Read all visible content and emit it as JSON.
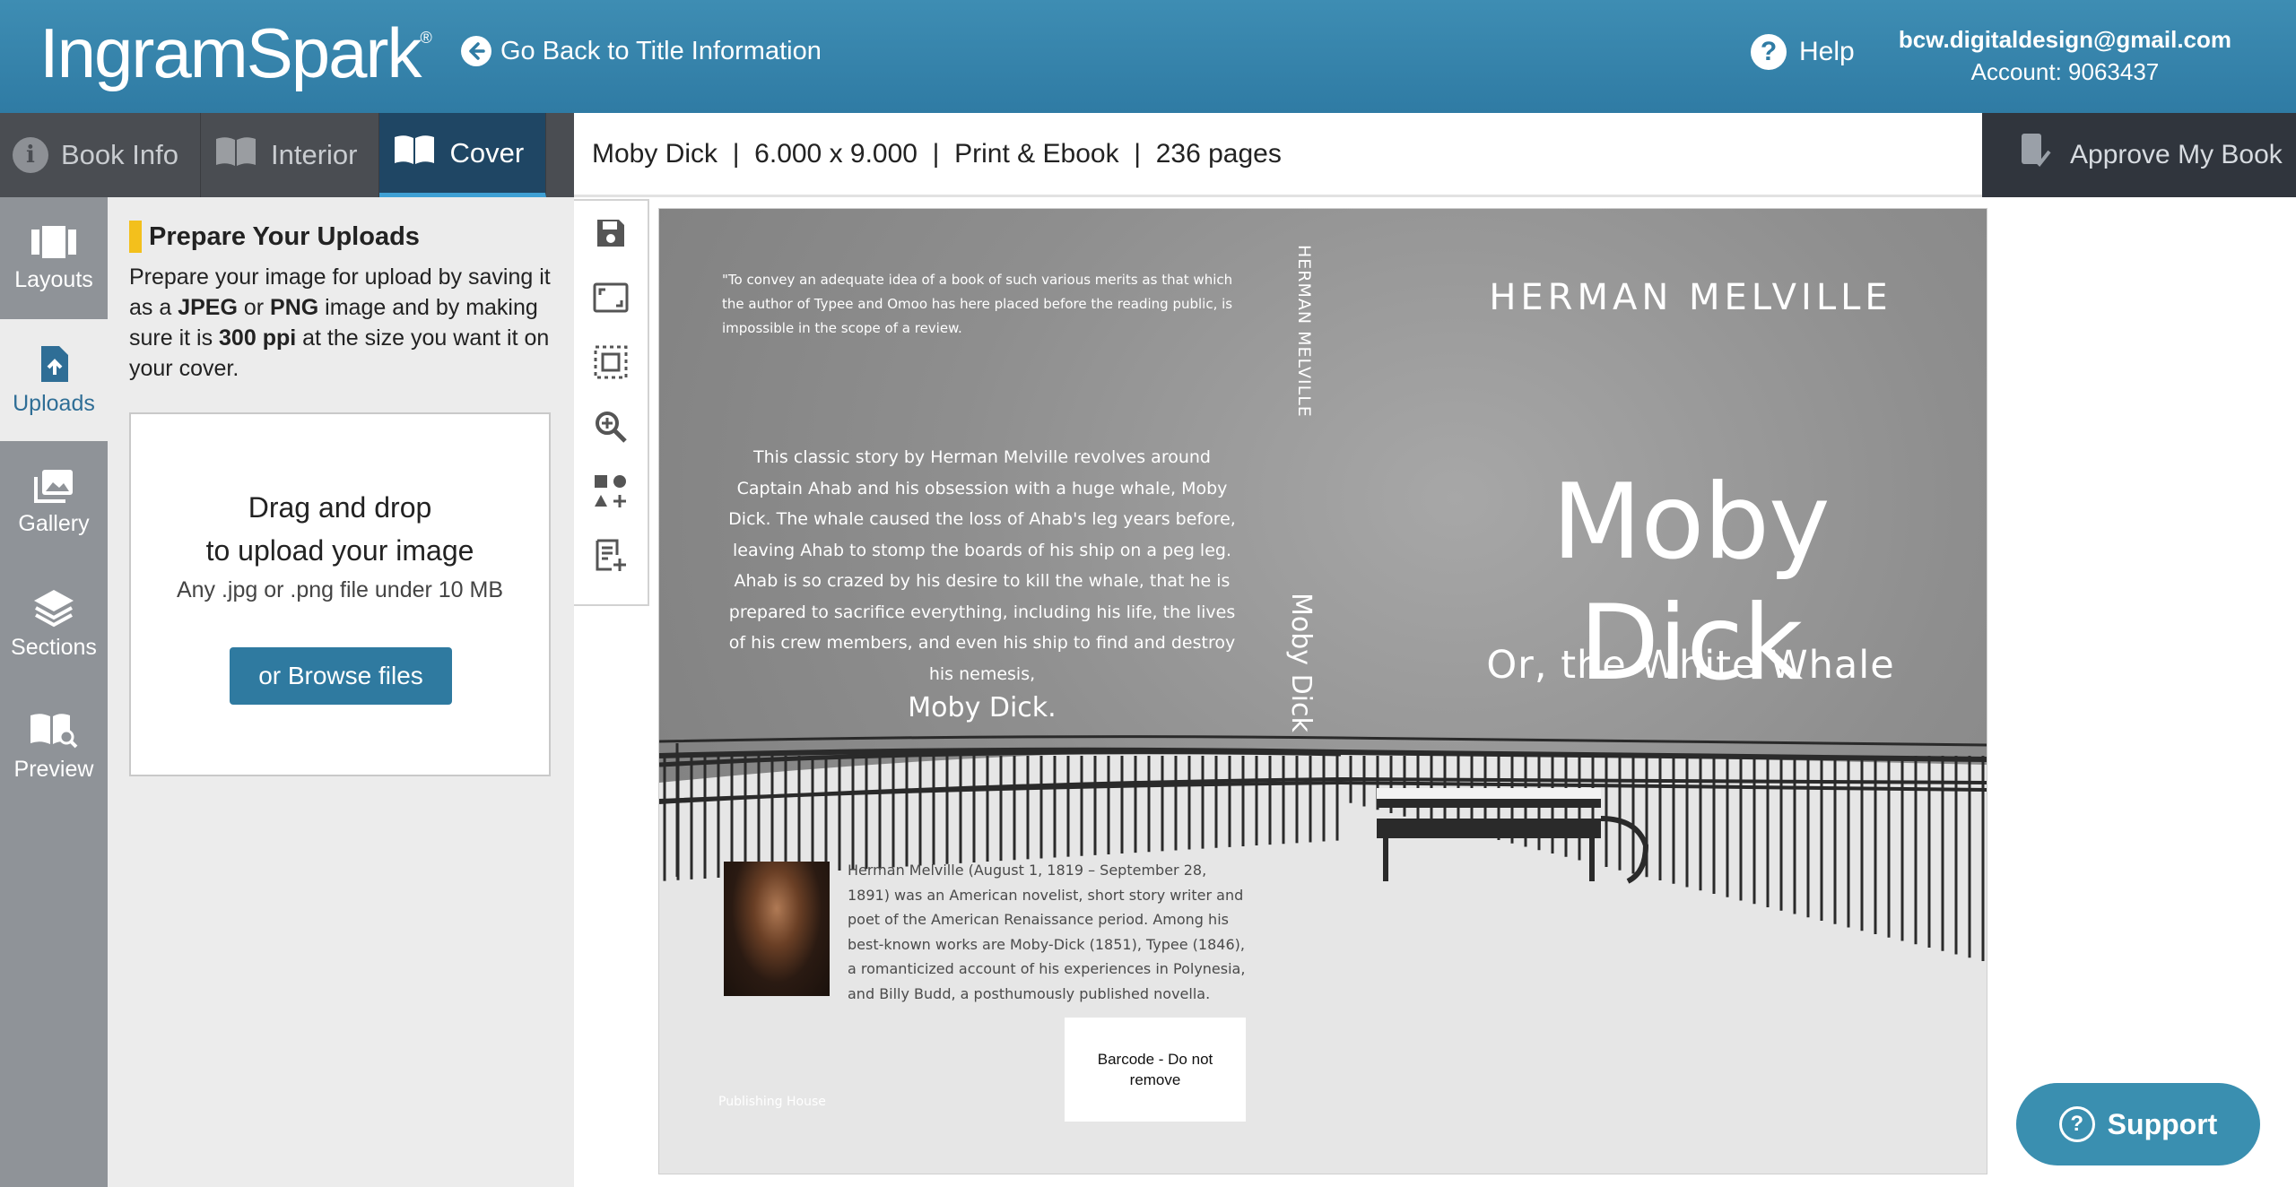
{
  "header": {
    "logo": "IngramSpark",
    "logo_mark": "®",
    "back_label": "Go Back to Title Information",
    "help_label": "Help",
    "account_email": "bcw.digitaldesign@gmail.com",
    "account_number": "Account: 9063437"
  },
  "tabs": [
    {
      "label": "Book Info",
      "icon": "info-icon"
    },
    {
      "label": "Interior",
      "icon": "book-open-icon"
    },
    {
      "label": "Cover",
      "icon": "book-cover-icon",
      "active": true
    }
  ],
  "titlebar": {
    "title": "Moby Dick",
    "trim": "6.000 x 9.000",
    "format": "Print & Ebook",
    "pages": "236 pages",
    "sep": "|"
  },
  "approve_label": "Approve My Book",
  "rail": [
    {
      "label": "Layouts",
      "icon": "layouts-icon"
    },
    {
      "label": "Uploads",
      "icon": "upload-icon",
      "active": true
    },
    {
      "label": "Gallery",
      "icon": "gallery-icon"
    },
    {
      "label": "Sections",
      "icon": "layers-icon"
    },
    {
      "label": "Preview",
      "icon": "preview-icon"
    }
  ],
  "panel": {
    "title": "Prepare Your Uploads",
    "desc_1": "Prepare your image for upload by saving it as a ",
    "desc_jpeg": "JPEG",
    "desc_or": " or ",
    "desc_png": "PNG",
    "desc_2": " image and by making sure it is ",
    "desc_ppi": "300 ppi",
    "desc_3": " at the size you want it on your cover.",
    "drop_line1": "Drag and drop",
    "drop_line2": "to upload your image",
    "drop_sub": "Any .jpg or .png file under 10 MB",
    "browse_label": "or Browse files"
  },
  "tools": [
    "save-icon",
    "fit-screen-icon",
    "select-area-icon",
    "zoom-in-icon",
    "add-shapes-icon",
    "add-text-icon"
  ],
  "cover": {
    "quote": "\"To convey an adequate idea of a book of such various merits as that which the author of Typee and Omoo has here placed before the reading public, is impossible in the scope of a review.",
    "blurb": "This classic story by Herman Melville revolves around Captain Ahab and his obsession with a huge whale, Moby Dick. The whale caused the loss of Ahab's leg years before, leaving Ahab to stomp the boards of his ship on a peg leg. Ahab is so crazed by his desire to kill the whale, that he is prepared to sacrifice everything, including his life, the lives of his crew members, and even his ship to find and destroy his nemesis,",
    "blurb_end": "Moby Dick.",
    "spine_author": "HERMAN MELVILLE",
    "spine_title": "Moby Dick",
    "front_author": "HERMAN MELVILLE",
    "front_title": "Moby Dick",
    "front_subtitle": "Or, the White Whale",
    "bio": "Herman Melville (August 1, 1819 – September 28, 1891) was an American novelist, short story writer and poet of the American Renaissance period. Among his best-known works are Moby-Dick (1851), Typee (1846), a romanticized account of his experiences in Polynesia, and Billy Budd, a posthumously published novella.",
    "barcode": "Barcode - Do not remove",
    "publisher": "Publishing House"
  },
  "support_label": "Support",
  "colors": {
    "header": "#2f7ba4",
    "tab_active": "#1f4664",
    "accent_yellow": "#f3c01c",
    "browse_button": "#2f7aa0",
    "support": "#3a8fb0"
  }
}
